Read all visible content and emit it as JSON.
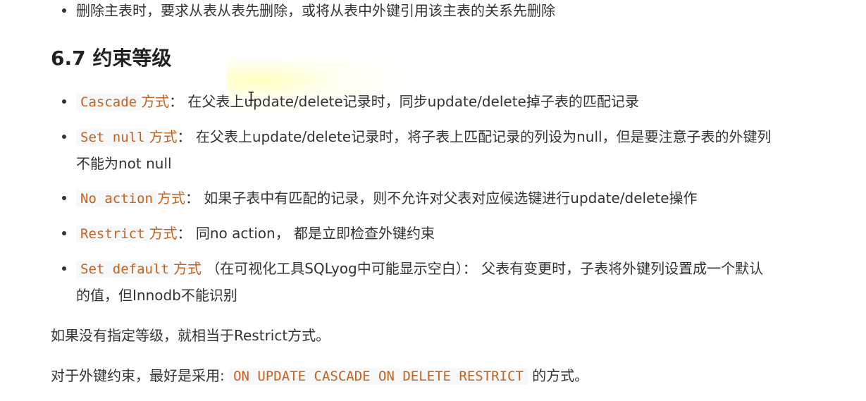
{
  "top_item": {
    "text": "删除主表时，要求从表从表先删除，或将从表中外键引用该主表的关系先删除"
  },
  "section": {
    "number": "6.7",
    "title": "约束等级"
  },
  "levels": [
    {
      "code": "Cascade",
      "suffix": "方式",
      "text": "： 在父表上update/delete记录时，同步update/delete掉子表的匹配记录",
      "continuation": ""
    },
    {
      "code": "Set null",
      "suffix": "方式",
      "text": "： 在父表上update/delete记录时，将子表上匹配记录的列设为null，但是要注意子表的外键列",
      "continuation": "不能为not null"
    },
    {
      "code": "No action",
      "suffix": "方式",
      "text": "： 如果子表中有匹配的记录，则不允许对父表对应候选键进行update/delete操作",
      "continuation": ""
    },
    {
      "code": "Restrict",
      "suffix": "方式",
      "text": "： 同no action， 都是立即检查外键约束",
      "continuation": ""
    },
    {
      "code": "Set default",
      "suffix": "方式",
      "text": " （在可视化工具SQLyog中可能显示空白）： 父表有变更时，子表将外键列设置成一个默认",
      "continuation": "的值，但Innodb不能识别"
    }
  ],
  "note1": "如果没有指定等级，就相当于Restrict方式。",
  "note2": {
    "prefix": "对于外键约束，最好是采用: ",
    "code": "ON UPDATE CASCADE ON DELETE RESTRICT",
    "suffix": " 的方式。"
  },
  "colors": {
    "code_text": "#c7611b",
    "code_bg": "#f6f8fa",
    "body_text": "#333333"
  }
}
